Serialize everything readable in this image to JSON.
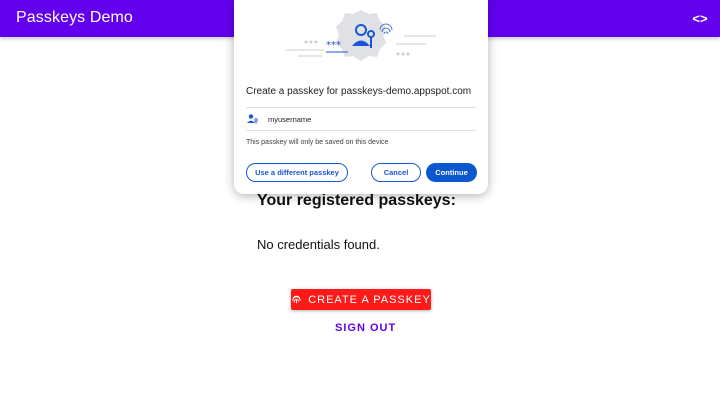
{
  "app": {
    "title": "Passkeys Demo",
    "code_icon": "code-icon"
  },
  "main": {
    "heading": "Your registered passkeys:",
    "empty_message": "No credentials found.",
    "create_button": "CREATE A PASSKEY",
    "create_button_icon": "fingerprint-icon",
    "sign_out": "SIGN OUT"
  },
  "dialog": {
    "title": "Create a passkey for passkeys-demo.appspot.com",
    "account_icon": "person-key-icon",
    "username": "myusername",
    "note": "This passkey will only be saved on this device",
    "use_different_button": "Use a different passkey",
    "cancel_button": "Cancel",
    "continue_button": "Continue"
  },
  "colors": {
    "appbar": "#6200ee",
    "create_button": "#ff1a1a",
    "dialog_primary": "#0b57d0"
  }
}
